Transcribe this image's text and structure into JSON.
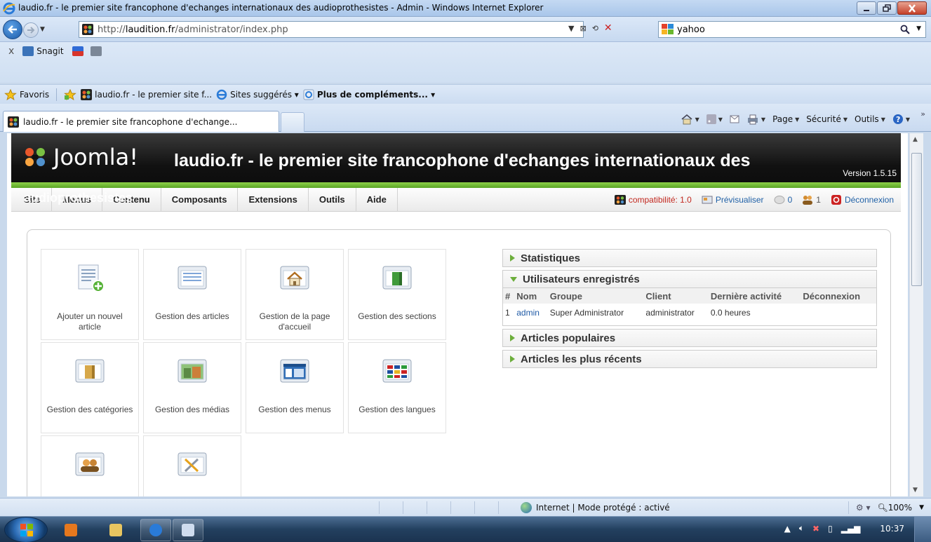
{
  "window": {
    "title": "laudio.fr - le premier site francophone d'echanges internationaux des audioprothesistes - Admin - Windows Internet Explorer"
  },
  "address_bar": {
    "url_prefix": "http://",
    "url_domain": "laudition.fr",
    "url_path": "/administrator/index.php",
    "search_value": "yahoo"
  },
  "command_bar": {
    "snagit_label": "Snagit"
  },
  "favorites_bar": {
    "favorites_label": "Favoris",
    "item1": "laudio.fr - le premier site f...",
    "item2": "Sites suggérés ▾",
    "item3": "Plus de compléments... ▾"
  },
  "tabs": {
    "active_label": "laudio.fr - le premier site francophone d'echange...",
    "tools": {
      "page": "Page",
      "security": "Sécurité",
      "tools": "Outils"
    }
  },
  "joomla": {
    "logo_word": "Joomla!",
    "site_title": "laudio.fr - le premier site francophone d'echanges internationaux des",
    "site_title_overflow": "audioprothesistes",
    "version": "Version 1.5.15",
    "menu": [
      "Site",
      "Menus",
      "Contenu",
      "Composants",
      "Extensions",
      "Outils",
      "Aide"
    ],
    "status": {
      "compat": "compatibilité: 1.0",
      "preview": "Prévisualiser",
      "messages": "0",
      "users": "1",
      "logout": "Déconnexion"
    },
    "icons": [
      {
        "label": "Ajouter un nouvel article"
      },
      {
        "label": "Gestion des articles"
      },
      {
        "label": "Gestion de la page d'accueil"
      },
      {
        "label": "Gestion des sections"
      },
      {
        "label": "Gestion des catégories"
      },
      {
        "label": "Gestion des médias"
      },
      {
        "label": "Gestion des menus"
      },
      {
        "label": "Gestion des langues"
      },
      {
        "label": ""
      },
      {
        "label": ""
      }
    ],
    "modules": {
      "stats": "Statistiques",
      "users": "Utilisateurs enregistrés",
      "popular": "Articles populaires",
      "recent": "Articles les plus récents",
      "users_table": {
        "headers": [
          "#",
          "Nom",
          "Groupe",
          "Client",
          "Dernière activité",
          "Déconnexion"
        ],
        "rows": [
          [
            "1",
            "admin",
            "Super Administrator",
            "administrator",
            "0.0 heures",
            ""
          ]
        ]
      }
    }
  },
  "status_bar": {
    "zone": "Internet | Mode protégé : activé",
    "zoom": "100%"
  },
  "taskbar": {
    "clock": "10:37"
  }
}
